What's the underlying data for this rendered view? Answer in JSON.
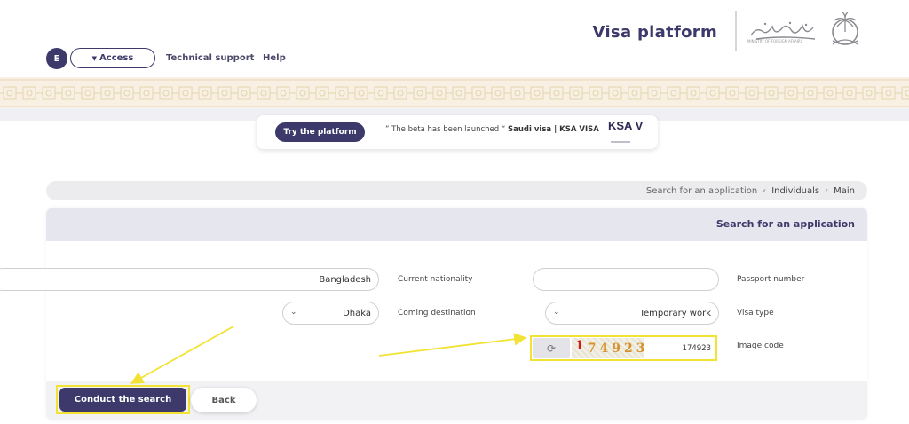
{
  "header": {
    "lang_label": "E",
    "access_label": "Access",
    "nav": {
      "technical_support": "Technical support",
      "help": "Help"
    },
    "platform_title": "Visa platform",
    "ministry_tagline": "MINISTRY OF FOREIGN AFFAIRS"
  },
  "promo": {
    "try_button": "Try the platform",
    "text_before": "” The beta has been launched “",
    "text_bold": "Saudi visa | KSA VISA",
    "logo_text": "KSA VISA"
  },
  "breadcrumb": {
    "current": "Search for an application",
    "level2": "Individuals",
    "level1": "Main"
  },
  "panel": {
    "title": "Search for an application",
    "fields": {
      "current_nationality": {
        "label": "Current nationality",
        "value": "Bangladesh"
      },
      "passport_number": {
        "label": "Passport number",
        "value": ""
      },
      "coming_destination": {
        "label": "Coming destination",
        "value": "Dhaka"
      },
      "visa_type": {
        "label": "Visa type",
        "value": "Temporary work"
      },
      "image_code": {
        "label": "Image code",
        "captcha_first": "1",
        "captcha_rest": "74923",
        "value": "174923"
      }
    },
    "buttons": {
      "search": "Conduct the search",
      "back": "Back"
    }
  },
  "colors": {
    "primary": "#3d3a6b",
    "highlight": "#f2e233",
    "band": "#f7f0e3"
  },
  "icons": {
    "refresh": "refresh-icon",
    "chevron": "chevron-down-icon",
    "caret": "caret-down-icon"
  }
}
